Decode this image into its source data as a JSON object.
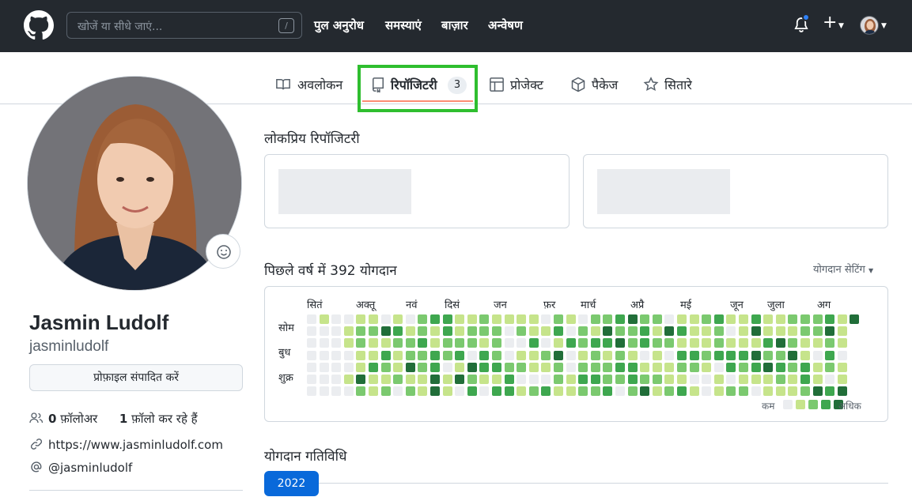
{
  "header": {
    "search_placeholder": "खोजें या सीधे जाएं...",
    "search_shortcut": "/",
    "nav": [
      "पुल अनुरोध",
      "समस्याएं",
      "बाज़ार",
      "अन्वेषण"
    ],
    "plus": "+",
    "logo_icon": "github-mark-icon",
    "notification_indicator": true
  },
  "tabs": {
    "overview": "अवलोकन",
    "repositories": "रिपॉजिटरी",
    "repositories_count": "3",
    "projects": "प्रोजेक्ट",
    "packages": "पैकेज",
    "stars": "सितारे",
    "active": "repositories",
    "active_highlight_color": "#2fbe2f"
  },
  "profile": {
    "name": "Jasmin Ludolf",
    "login": "jasminludolf",
    "edit_button": "प्रोफ़ाइल संपादित करें",
    "followers_count": "0",
    "followers_label": "फ़ॉलोअर",
    "following_count": "1",
    "following_label": "फ़ॉलो कर रहे हैं",
    "website": "https://www.jasminludolf.com",
    "twitter": "@jasminludolf"
  },
  "popular": {
    "title": "लोकप्रिय रिपॉजिटरी"
  },
  "contributions": {
    "title": "पिछले वर्ष में 392 योगदान",
    "settings": "योगदान सेटिंग",
    "months": [
      "सितं",
      "अक्तू",
      "नवं",
      "दिसं",
      "जन",
      "फ़र",
      "मार्च",
      "अप्रै",
      "मई",
      "जून",
      "जुला",
      "अग"
    ],
    "days": [
      "सोम",
      "बुध",
      "शुक्र"
    ],
    "legend_less": "कम",
    "legend_more": "अधिक",
    "palette": [
      "#ebedf0",
      "#c6e48b",
      "#7bc96f",
      "#3ea74f",
      "#216e39"
    ]
  },
  "activity": {
    "title": "योगदान गतिविधि",
    "year": "2022"
  }
}
